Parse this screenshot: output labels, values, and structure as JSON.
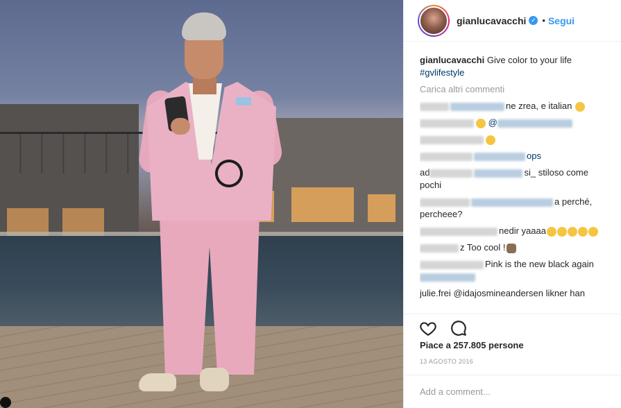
{
  "post": {
    "username": "gianlucavacchi",
    "follow_label": "Segui",
    "dot": "•",
    "verified_glyph": "✓"
  },
  "caption": {
    "username": "gianlucavacchi",
    "text": "Give color to your life",
    "hashtag": "#gvlifestyle"
  },
  "load_more": "Carica altri commenti",
  "comments": [
    {
      "text": "ne zrea, e italian",
      "emojis": [
        "heart-eyes-emoji"
      ]
    },
    {
      "text": "@",
      "emojis": [
        "smile-emoji"
      ]
    },
    {
      "text": "",
      "emojis": [
        "face-emoji"
      ]
    },
    {
      "text": "ops",
      "emojis": []
    },
    {
      "text": "ad",
      "text2": "si_ stiloso come pochi",
      "emojis": []
    },
    {
      "text": "a perché, percheee?",
      "emojis": []
    },
    {
      "text": "nedir yaaaa",
      "emojis": [
        "grimace-emoji",
        "surprised-emoji",
        "surprised-emoji",
        "surprised-emoji",
        "surprised-emoji"
      ]
    },
    {
      "text": "z Too cool !",
      "emojis": [
        "pray-emoji"
      ]
    },
    {
      "text": "Pink is the new black again",
      "emojis": []
    },
    {
      "text": "julie.frei @idajosmineandersen likner han",
      "emojis": []
    }
  ],
  "likes": "Piace a 257.805 persone",
  "date": "13 AGOSTO 2016",
  "add_comment_placeholder": "Add a comment..."
}
